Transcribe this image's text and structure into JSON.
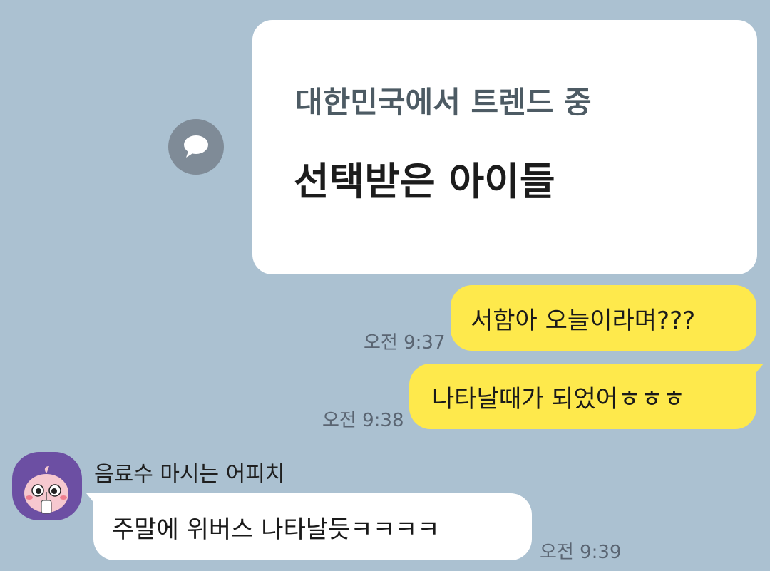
{
  "link_card": {
    "subtitle": "대한민국에서 트렌드 중",
    "title": "선택받은 아이들",
    "share_icon": "speech-bubble-icon"
  },
  "messages": [
    {
      "from": "me",
      "text": "서함아 오늘이라며???",
      "time": "오전 9:37"
    },
    {
      "from": "me",
      "text": "나타날때가 되었어ㅎㅎㅎ",
      "time": "오전 9:38"
    },
    {
      "from": "other",
      "sender": "음료수 마시는 어피치",
      "text": "주말에 위버스 나타날듯ㅋㅋㅋㅋ",
      "time": "오전 9:39"
    }
  ],
  "colors": {
    "background": "#abc1d1",
    "my_bubble": "#fee94c",
    "other_bubble": "#ffffff",
    "avatar_bg": "#6c4fa3"
  }
}
